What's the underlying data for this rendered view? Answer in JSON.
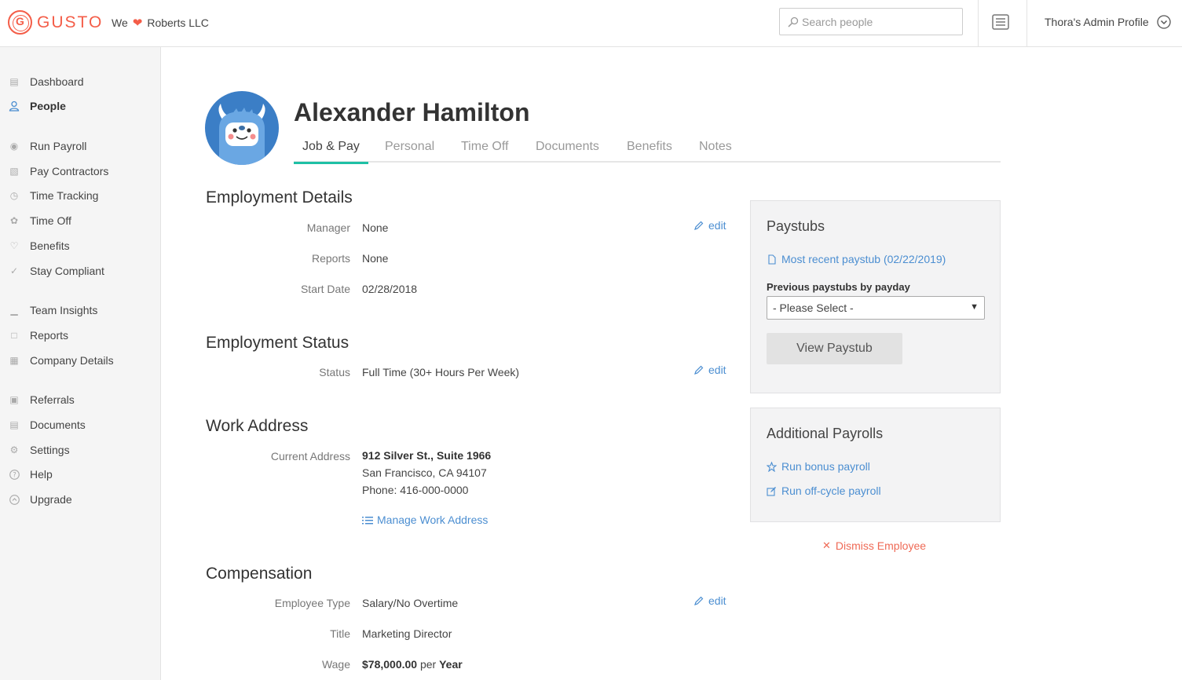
{
  "brand": {
    "logo_letter": "G",
    "name": "GUSTO",
    "we": "We",
    "company": "Roberts LLC",
    "accent": "#f45d48"
  },
  "search": {
    "placeholder": "Search people"
  },
  "header": {
    "profile_label": "Thora's Admin Profile"
  },
  "sidebar": {
    "items": [
      {
        "label": "Dashboard",
        "icon": "dashboard-icon"
      },
      {
        "label": "People",
        "icon": "person-icon",
        "active": true
      },
      {
        "label": "Run Payroll",
        "icon": "money-bag-icon"
      },
      {
        "label": "Pay Contractors",
        "icon": "cash-icon"
      },
      {
        "label": "Time Tracking",
        "icon": "clock-icon"
      },
      {
        "label": "Time Off",
        "icon": "palm-tree-icon"
      },
      {
        "label": "Benefits",
        "icon": "heart-hands-icon"
      },
      {
        "label": "Stay Compliant",
        "icon": "checkmark-icon"
      },
      {
        "label": "Team Insights",
        "icon": "bar-chart-icon"
      },
      {
        "label": "Reports",
        "icon": "folder-icon"
      },
      {
        "label": "Company Details",
        "icon": "building-icon"
      },
      {
        "label": "Referrals",
        "icon": "gift-icon"
      },
      {
        "label": "Documents",
        "icon": "document-icon"
      },
      {
        "label": "Settings",
        "icon": "gear-icon"
      },
      {
        "label": "Help",
        "icon": "question-icon"
      },
      {
        "label": "Upgrade",
        "icon": "upgrade-icon"
      }
    ]
  },
  "employee": {
    "name": "Alexander Hamilton"
  },
  "tabs": [
    "Job & Pay",
    "Personal",
    "Time Off",
    "Documents",
    "Benefits",
    "Notes"
  ],
  "edit_label": "edit",
  "employment_details": {
    "title": "Employment Details",
    "manager_label": "Manager",
    "manager_value": "None",
    "reports_label": "Reports",
    "reports_value": "None",
    "start_label": "Start Date",
    "start_value": "02/28/2018"
  },
  "employment_status": {
    "title": "Employment Status",
    "status_label": "Status",
    "status_value": "Full Time (30+ Hours Per Week)"
  },
  "work_address": {
    "title": "Work Address",
    "label": "Current Address",
    "line1": "912 Silver St., Suite 1966",
    "line2": "San Francisco, CA 94107",
    "phone": "Phone: 416-000-0000",
    "manage_link": "Manage Work Address"
  },
  "compensation": {
    "title": "Compensation",
    "type_label": "Employee Type",
    "type_value": "Salary/No Overtime",
    "title_label": "Title",
    "title_value": "Marketing Director",
    "wage_label": "Wage",
    "wage_amount": "$78,000.00",
    "wage_per": "per",
    "wage_period": "Year"
  },
  "paystubs": {
    "title": "Paystubs",
    "recent_link": "Most recent paystub (02/22/2019)",
    "previous_label": "Previous paystubs by payday",
    "select_value": "- Please Select -",
    "view_button": "View Paystub"
  },
  "additional_payrolls": {
    "title": "Additional Payrolls",
    "bonus_link": "Run bonus payroll",
    "offcycle_link": "Run off-cycle payroll"
  },
  "dismiss_label": "Dismiss Employee"
}
